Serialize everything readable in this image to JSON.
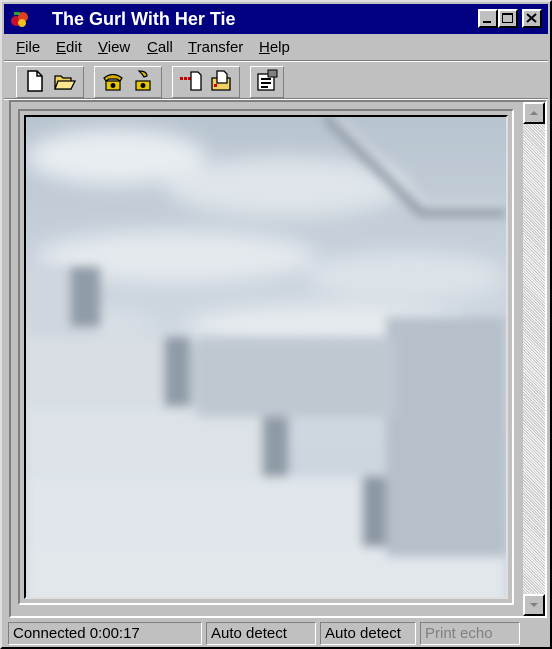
{
  "window": {
    "title": "The Gurl With Her Tie"
  },
  "titlebar_buttons": {
    "minimize": "minimize-icon",
    "maximize": "maximize-icon",
    "close": "close-icon"
  },
  "menu": {
    "items": [
      {
        "label": "File",
        "mnemonic": "F",
        "rest": "ile"
      },
      {
        "label": "Edit",
        "mnemonic": "E",
        "rest": "dit"
      },
      {
        "label": "View",
        "mnemonic": "V",
        "rest": "iew"
      },
      {
        "label": "Call",
        "mnemonic": "C",
        "rest": "all"
      },
      {
        "label": "Transfer",
        "mnemonic": "T",
        "rest": "ransfer"
      },
      {
        "label": "Help",
        "mnemonic": "H",
        "rest": "elp"
      }
    ]
  },
  "toolbar": {
    "icons": [
      "new-file-icon",
      "open-folder-icon",
      "phone-connect-icon",
      "phone-disconnect-icon",
      "send-file-icon",
      "receive-file-icon",
      "properties-icon"
    ]
  },
  "status": {
    "connection": "Connected 0:00:17",
    "emulation": "Auto detect",
    "format": "Auto detect",
    "print_echo": "Print echo"
  },
  "colors": {
    "titlebar": "#000080",
    "face": "#c0c0c0",
    "disabled_text": "#808080"
  }
}
